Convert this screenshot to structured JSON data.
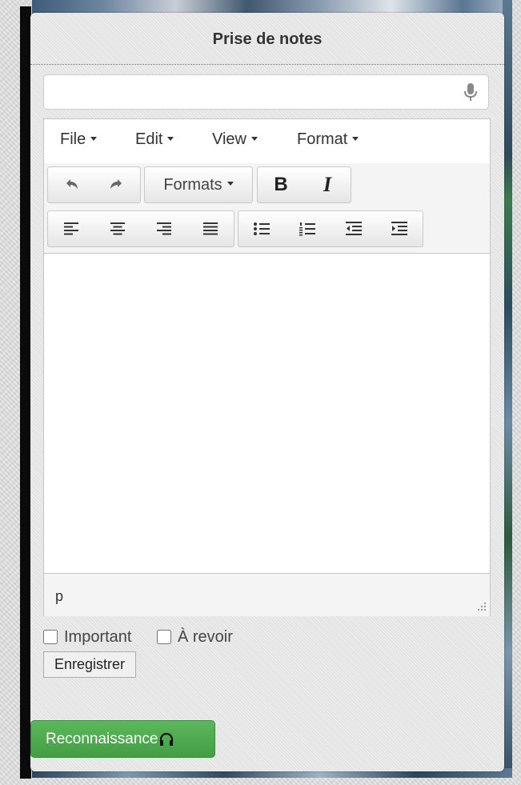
{
  "panel": {
    "title": "Prise de notes"
  },
  "voice_input": {
    "value": "",
    "placeholder": ""
  },
  "editor": {
    "menus": [
      "File",
      "Edit",
      "View",
      "Format"
    ],
    "formats_label": "Formats",
    "bold_label": "B",
    "italic_label": "I",
    "status_path": "p",
    "content": ""
  },
  "options": {
    "important_label": "Important",
    "review_label": "À revoir"
  },
  "actions": {
    "save_label": "Enregistrer",
    "recognition_label": "Reconnaissance"
  },
  "icons": [
    "microphone-icon",
    "undo-icon",
    "redo-icon",
    "align-left-icon",
    "align-center-icon",
    "align-right-icon",
    "align-justify-icon",
    "bullet-list-icon",
    "numbered-list-icon",
    "outdent-icon",
    "indent-icon",
    "resize-grip-icon",
    "headphones-icon"
  ],
  "colors": {
    "primary_green": "#5cb85c",
    "panel_bg": "#e8e8e8"
  }
}
